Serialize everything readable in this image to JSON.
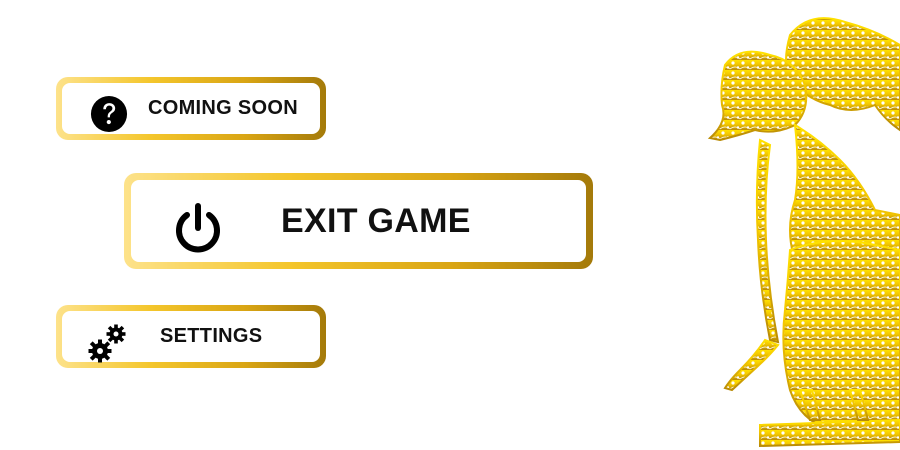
{
  "menu": {
    "coming_soon": {
      "label": "COMING SOON",
      "icon": "question-circle-icon"
    },
    "exit_game": {
      "label": "EXIT GAME",
      "icon": "power-icon"
    },
    "settings": {
      "label": "SETTINGS",
      "icon": "gears-icon"
    }
  },
  "decoration": {
    "icon": "wayang-puppet-icon"
  },
  "colors": {
    "gold_light": "#fde28a",
    "gold": "#f4c62c",
    "gold_dark": "#a47a0a",
    "text": "#111111",
    "background": "#ffffff"
  }
}
